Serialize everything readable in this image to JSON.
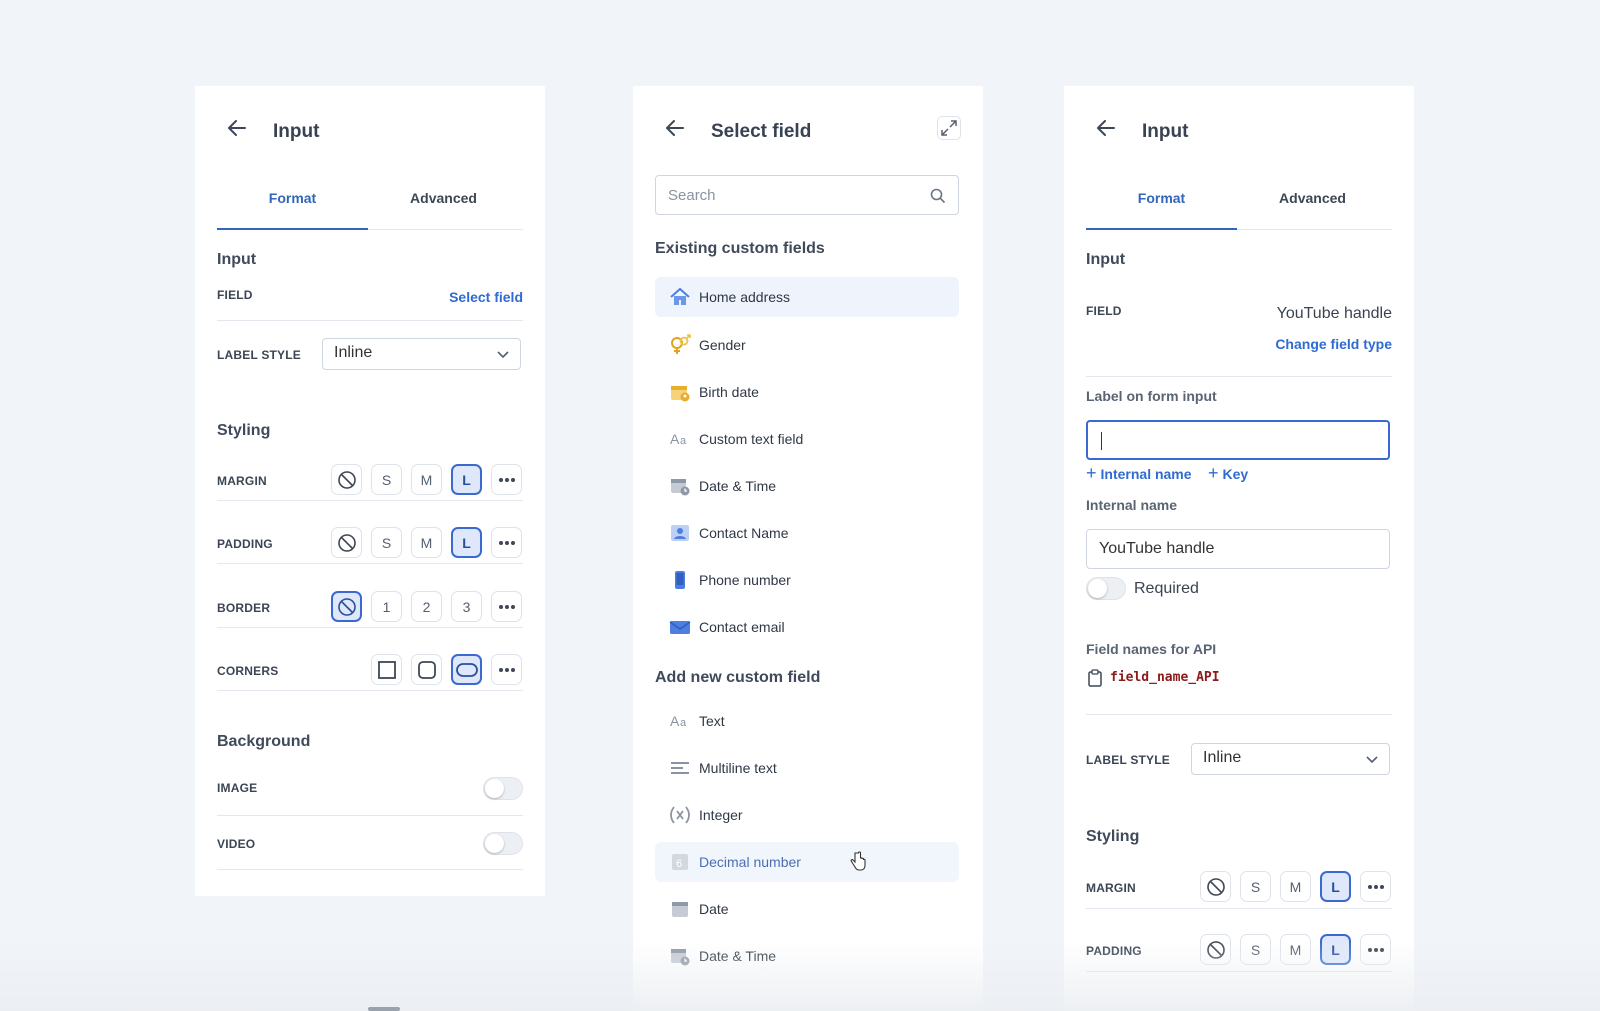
{
  "left_panel": {
    "title": "Input",
    "tabs": [
      "Format",
      "Advanced"
    ],
    "input_section": "Input",
    "field_label": "FIELD",
    "select_field": "Select field",
    "label_style_label": "LABEL STYLE",
    "label_style_value": "Inline",
    "styling_section": "Styling",
    "margin_label": "MARGIN",
    "padding_label": "PADDING",
    "border_label": "BORDER",
    "corners_label": "CORNERS",
    "size_options": [
      "S",
      "M",
      "L"
    ],
    "border_options": [
      "1",
      "2",
      "3"
    ],
    "background_section": "Background",
    "image_label": "IMAGE",
    "video_label": "VIDEO"
  },
  "mid_panel": {
    "title": "Select field",
    "search_placeholder": "Search",
    "existing_heading": "Existing custom fields",
    "existing": [
      {
        "label": "Home address",
        "icon": "home-icon"
      },
      {
        "label": "Gender",
        "icon": "gender-icon"
      },
      {
        "label": "Birth date",
        "icon": "birth-date-icon"
      },
      {
        "label": "Custom text field",
        "icon": "text-icon"
      },
      {
        "label": "Date & Time",
        "icon": "datetime-icon"
      },
      {
        "label": "Contact Name",
        "icon": "contact-icon"
      },
      {
        "label": "Phone number",
        "icon": "phone-icon"
      },
      {
        "label": "Contact email",
        "icon": "email-icon"
      }
    ],
    "new_heading": "Add new custom field",
    "new": [
      {
        "label": "Text",
        "icon": "text-icon"
      },
      {
        "label": "Multiline text",
        "icon": "multiline-icon"
      },
      {
        "label": "Integer",
        "icon": "integer-icon"
      },
      {
        "label": "Decimal number",
        "icon": "decimal-icon"
      },
      {
        "label": "Date",
        "icon": "calendar-icon"
      },
      {
        "label": "Date & Time",
        "icon": "datetime-icon"
      }
    ]
  },
  "right_panel": {
    "title": "Input",
    "tabs": [
      "Format",
      "Advanced"
    ],
    "input_section": "Input",
    "field_label": "FIELD",
    "field_value": "YouTube handle",
    "change_field_type": "Change field type",
    "label_on_form_input": "Label on form input",
    "internal_name_link": "Internal name",
    "key_link": "Key",
    "internal_name_label": "Internal name",
    "internal_name_value": "YouTube handle",
    "required_label": "Required",
    "api_label": "Field names for API",
    "api_value": "field_name_API",
    "label_style_label": "LABEL STYLE",
    "label_style_value": "Inline",
    "styling_section": "Styling",
    "margin_label": "MARGIN",
    "padding_label": "PADDING"
  },
  "colors": {
    "accent": "#3366b8",
    "selected_bg": "#dfe8fb",
    "code": "#8b1a1a"
  }
}
